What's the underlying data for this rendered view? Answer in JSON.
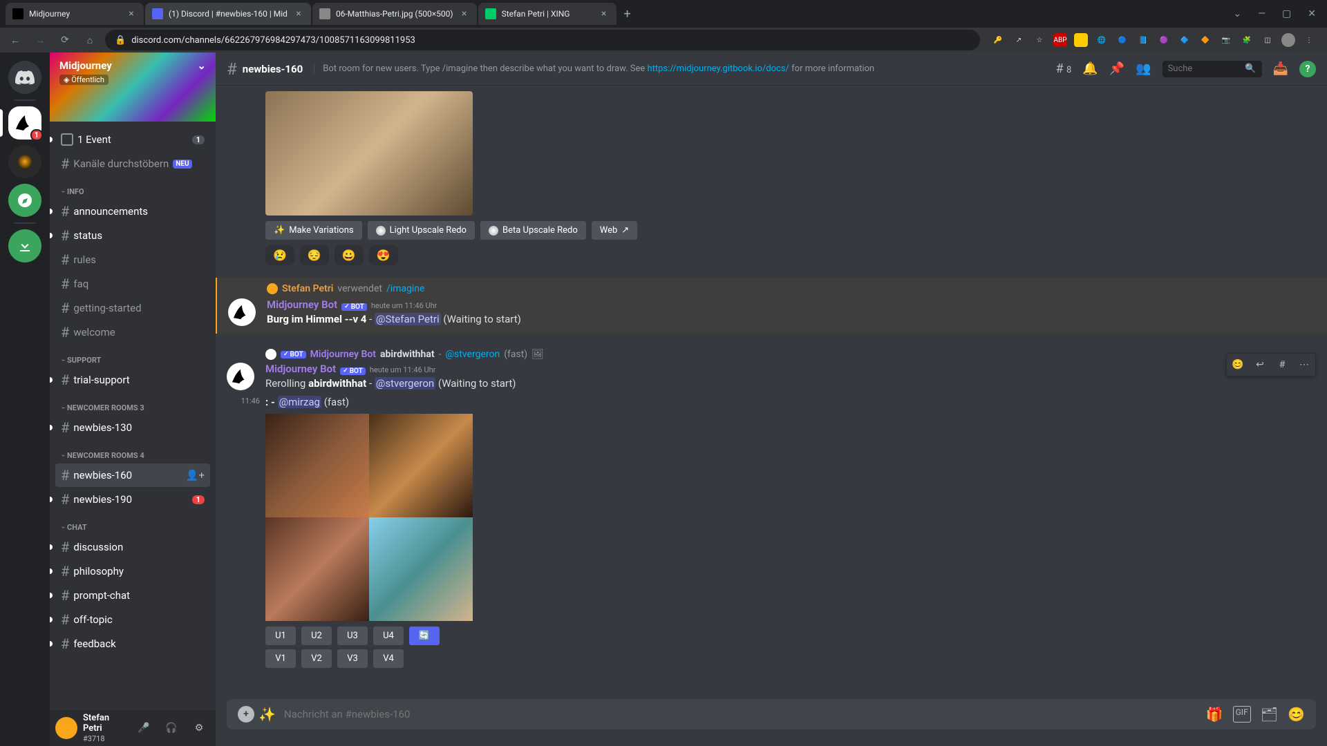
{
  "browser": {
    "tabs": [
      {
        "title": "Midjourney",
        "iconColor": "#000"
      },
      {
        "title": "(1) Discord | #newbies-160 | Mid",
        "iconColor": "#5865f2",
        "active": true
      },
      {
        "title": "06-Matthias-Petri.jpg (500×500)",
        "iconColor": "#888"
      },
      {
        "title": "Stefan Petri | XING",
        "iconColor": "#0c6"
      }
    ],
    "url": "discord.com/channels/662267976984297473/1008571163099811953"
  },
  "server": {
    "name": "Midjourney",
    "public": "Öffentlich"
  },
  "events": {
    "label": "1 Event",
    "count": "1"
  },
  "browse": {
    "label": "Kanäle durchstöbern",
    "tag": "NEU"
  },
  "categories": {
    "info": "INFO",
    "support": "SUPPORT",
    "newcomer3": "NEWCOMER ROOMS 3",
    "newcomer4": "NEWCOMER ROOMS 4",
    "chat": "CHAT"
  },
  "channels": {
    "announcements": "announcements",
    "status": "status",
    "rules": "rules",
    "faq": "faq",
    "getting_started": "getting-started",
    "welcome": "welcome",
    "trial_support": "trial-support",
    "newbies_130": "newbies-130",
    "newbies_160": "newbies-160",
    "newbies_190": "newbies-190",
    "newbies_190_badge": "1",
    "discussion": "discussion",
    "philosophy": "philosophy",
    "prompt_chat": "prompt-chat",
    "off_topic": "off-topic",
    "feedback": "feedback"
  },
  "user": {
    "name": "Stefan Petri",
    "tag": "#3718"
  },
  "header": {
    "channel": "newbies-160",
    "topic_pre": "Bot room for new users. Type /imagine then describe what you want to draw. See ",
    "topic_link": "https://midjourney.gitbook.io/docs/",
    "topic_post": " for more information",
    "threads_count": "8",
    "search_placeholder": "Suche"
  },
  "buttons": {
    "make_variations": "Make Variations",
    "light_upscale": "Light Upscale Redo",
    "beta_upscale": "Beta Upscale Redo",
    "web": "Web",
    "u1": "U1",
    "u2": "U2",
    "u3": "U3",
    "u4": "U4",
    "v1": "V1",
    "v2": "V2",
    "v3": "V3",
    "v4": "V4",
    "reroll": "🔄"
  },
  "reactions": {
    "r1": "😢",
    "r2": "😔",
    "r3": "😀",
    "r4": "😍"
  },
  "messages": {
    "sys_user": "Stefan Petri",
    "sys_verb": " verwendet ",
    "sys_cmd": "/imagine",
    "bot_name": "Midjourney Bot",
    "bot_badge": "BOT",
    "bot_time": "heute um 11:46 Uhr",
    "burg_prompt": "Burg im Himmel --v 4",
    "burg_dash": " - ",
    "burg_mention": "@Stefan Petri",
    "burg_status": " (Waiting to start)",
    "reply_subject": "abirdwithhat",
    "reply_dash": " - ",
    "reply_mention": "@stvergeron",
    "reply_fast": " (fast)",
    "reroll_pre": "Rerolling ",
    "reroll_subject": "abirdwithhat",
    "reroll_dash": " - ",
    "reroll_mention": "@stvergeron",
    "reroll_status": " (Waiting to start)",
    "compact_time": "11:46",
    "compact_colon": ": - ",
    "compact_mention": "@mirzag",
    "compact_fast": " (fast)"
  },
  "input": {
    "placeholder": "Nachricht an #newbies-160"
  }
}
